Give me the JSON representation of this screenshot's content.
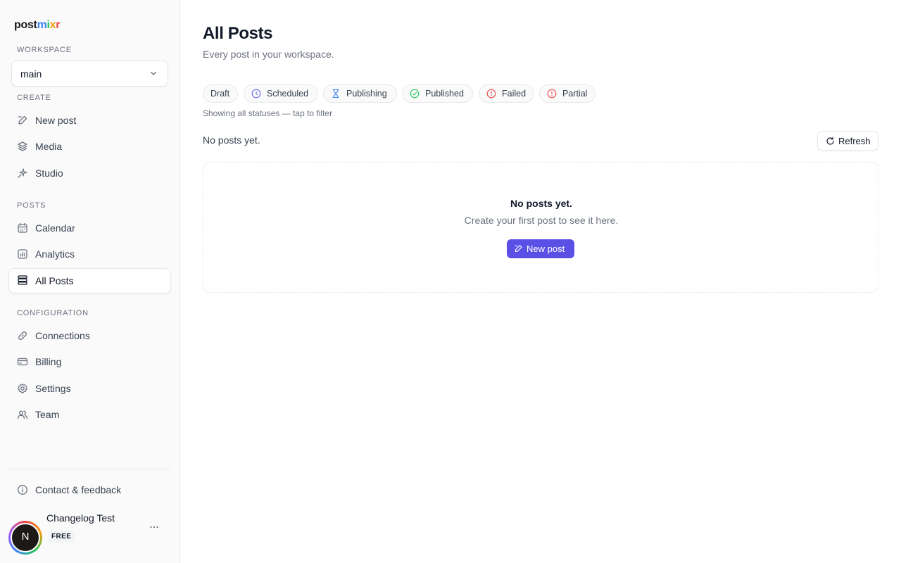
{
  "brand": {
    "logo_post": "post",
    "logo_m": "m",
    "logo_i": "i",
    "logo_x": "x",
    "logo_r": "r"
  },
  "sidebar": {
    "workspace_label": "WORKSPACE",
    "workspace_value": "main",
    "create_label": "CREATE",
    "create_items": [
      {
        "label": "New post",
        "icon": "new-post-icon"
      },
      {
        "label": "Media",
        "icon": "layers-icon"
      },
      {
        "label": "Studio",
        "icon": "sparkle-icon"
      }
    ],
    "posts_label": "POSTS",
    "posts_items": [
      {
        "label": "Calendar",
        "icon": "calendar-icon"
      },
      {
        "label": "Analytics",
        "icon": "chart-icon"
      },
      {
        "label": "All Posts",
        "icon": "list-icon",
        "active": true
      }
    ],
    "config_label": "CONFIGURATION",
    "config_items": [
      {
        "label": "Connections",
        "icon": "link-icon"
      },
      {
        "label": "Billing",
        "icon": "credit-card-icon"
      },
      {
        "label": "Settings",
        "icon": "gear-icon"
      },
      {
        "label": "Team",
        "icon": "users-icon"
      }
    ],
    "contact_label": "Contact & feedback",
    "user": {
      "name": "Changelog Test",
      "initial": "N",
      "plan": "FREE"
    }
  },
  "main": {
    "title": "All Posts",
    "subtitle": "Every post in your workspace.",
    "filters": [
      {
        "label": "Draft",
        "icon": ""
      },
      {
        "label": "Scheduled",
        "icon": "clock-icon"
      },
      {
        "label": "Publishing",
        "icon": "hourglass-icon"
      },
      {
        "label": "Published",
        "icon": "check-circle-icon"
      },
      {
        "label": "Failed",
        "icon": "alert-circle-icon"
      },
      {
        "label": "Partial",
        "icon": "alert-circle-icon"
      }
    ],
    "filter_hint": "Showing all statuses — tap to filter",
    "count_text": "No posts yet.",
    "refresh_label": "Refresh",
    "empty_title": "No posts yet.",
    "empty_desc": "Create your first post to see it here.",
    "empty_button": "New post"
  },
  "colors": {
    "accent": "#5b50e6",
    "scheduled": "#6366f1",
    "publishing": "#3b82f6",
    "published": "#22c55e",
    "failed": "#ef4444",
    "partial": "#ef4444"
  }
}
